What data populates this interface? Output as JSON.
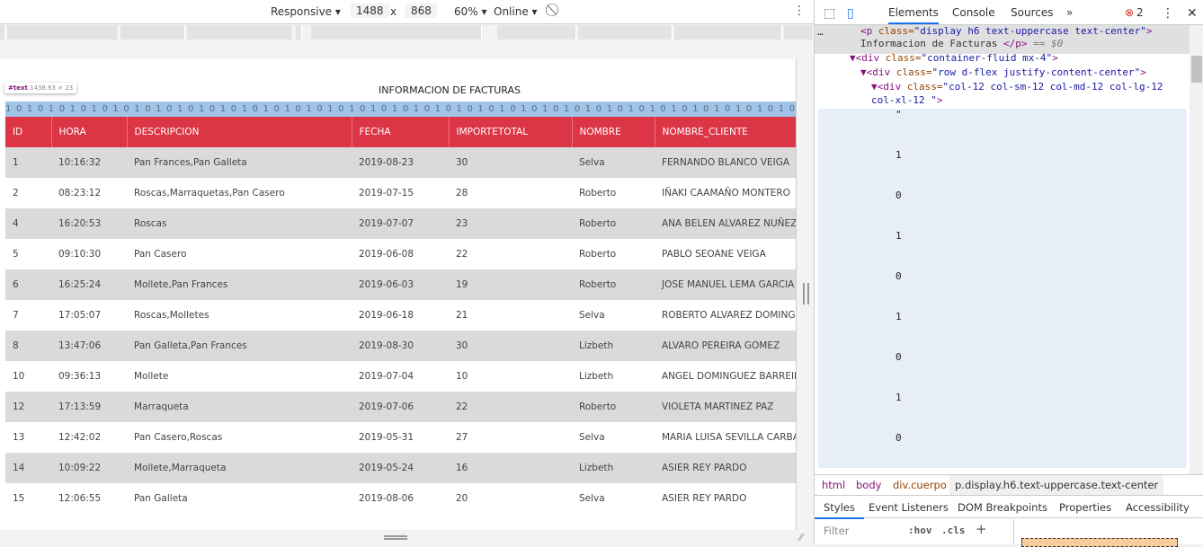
{
  "device_toolbar": {
    "device": "Responsive",
    "width": "1488",
    "x": "x",
    "height": "868",
    "zoom": "60%",
    "throttle": "Online"
  },
  "page": {
    "title": "INFORMACION DE FACTURAS",
    "tooltip": {
      "node": "#text",
      "size": "1438.63 × 23"
    },
    "highlight_text": "1 0 1 0 1 0 1 0 1 0 1 0 1 0 1 0 1 0 1 0 1 0 1 0 1 0 1 0 1 0 1 0 1 0 1 0 1 0 1 0 1 0 1 0 1 0 1 0 1 0 1 0 1 0 1 0 1 0 1 0 1 0 1 0 1 0 1 0 1 0 1 0 1 0 1 0 1 0 1 0 1 0 1 0 1 0 1 0 1 0 1 0 1 0 1 0",
    "columns": [
      "ID",
      "HORA",
      "DESCRIPCION",
      "FECHA",
      "IMPORTETOTAL",
      "NOMBRE",
      "NOMBRE_CLIENTE"
    ],
    "rows": [
      [
        "1",
        "10:16:32",
        "Pan Frances,Pan Galleta",
        "2019-08-23",
        "30",
        "Selva",
        "FERNANDO BLANCO VEIGA"
      ],
      [
        "2",
        "08:23:12",
        "Roscas,Marraquetas,Pan Casero",
        "2019-07-15",
        "28",
        "Roberto",
        "IÑAKI CAAMAÑO MONTERO"
      ],
      [
        "4",
        "16:20:53",
        "Roscas",
        "2019-07-07",
        "23",
        "Roberto",
        "ANA BELEN ALVAREZ NUÑEZ"
      ],
      [
        "5",
        "09:10:30",
        "Pan Casero",
        "2019-06-08",
        "22",
        "Roberto",
        "PABLO SEOANE VEIGA"
      ],
      [
        "6",
        "16:25:24",
        "Mollete,Pan Frances",
        "2019-06-03",
        "19",
        "Roberto",
        "JOSE MANUEL LEMA GARCIA"
      ],
      [
        "7",
        "17:05:07",
        "Roscas,Molletes",
        "2019-06-18",
        "21",
        "Selva",
        "ROBERTO ALVAREZ DOMINGUEZ"
      ],
      [
        "8",
        "13:47:06",
        "Pan Galleta,Pan Frances",
        "2019-08-30",
        "30",
        "Lizbeth",
        "ALVARO PEREIRA GOMEZ"
      ],
      [
        "10",
        "09:36:13",
        "Mollete",
        "2019-07-04",
        "10",
        "Lizbeth",
        "ANGEL DOMINGUEZ BARREIRO"
      ],
      [
        "12",
        "17:13:59",
        "Marraqueta",
        "2019-07-06",
        "22",
        "Roberto",
        "VIOLETA MARTINEZ PAZ"
      ],
      [
        "13",
        "12:42:02",
        "Pan Casero,Roscas",
        "2019-05-31",
        "27",
        "Selva",
        "MARIA LUISA SEVILLA CARBALLO"
      ],
      [
        "14",
        "10:09:22",
        "Mollete,Marraqueta",
        "2019-05-24",
        "16",
        "Lizbeth",
        "ASIER REY PARDO"
      ],
      [
        "15",
        "12:06:55",
        "Pan Galleta",
        "2019-08-06",
        "20",
        "Selva",
        "ASIER REY PARDO"
      ]
    ],
    "header_color": "#dc3545"
  },
  "devtools": {
    "tabs": [
      "Elements",
      "Console",
      "Sources"
    ],
    "error_count": "2",
    "code": {
      "l1_tag": "<p",
      "l1_attr": " class=",
      "l1_val": "\"display h6 text-uppercase text-center\"",
      "l1_end": ">",
      "l2_text": "Informacion de Facturas ",
      "l2_close": "</p>",
      "l2_eq": " == $0",
      "l3_tag": "▼<div",
      "l3_attr": " class=",
      "l3_val": "\"container-fluid mx-4\"",
      "l3_end": ">",
      "l4_tag": "▼<div",
      "l4_attr": " class=",
      "l4_val": "\"row d-flex justify-content-center\"",
      "l4_end": ">",
      "l5_tag": "▼<div",
      "l5_attr": " class=",
      "l5_val": "\"col-12 col-sm-12 col-md-12 col-lg-12",
      "l6_val": "col-xl-12 \"",
      "l6_end": ">",
      "quote": "\"",
      "bits": [
        "1",
        "0",
        "1",
        "0",
        "1",
        "0",
        "1",
        "0"
      ]
    },
    "breadcrumbs": [
      "html",
      "body",
      "div.cuerpo",
      "p.display.h6.text-uppercase.text-center"
    ],
    "subtabs": [
      "Styles",
      "Event Listeners",
      "DOM Breakpoints",
      "Properties",
      "Accessibility"
    ],
    "filter_placeholder": "Filter",
    "hov": ":hov",
    "cls": ".cls",
    "plus": "+"
  }
}
